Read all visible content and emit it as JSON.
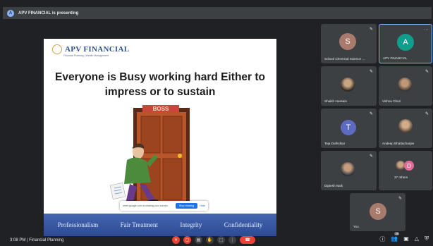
{
  "presenting_banner": "APV FINANCIAL is presenting",
  "presenter_initial": "A",
  "slide": {
    "logo_text": "APV FINANCIAL",
    "logo_subtitle": "Financial Planning | Wealth Management",
    "title_line1": "Everyone is Busy working hard Either to",
    "title_line2": "impress or to sustain",
    "door_sign": "BOSS",
    "footer": [
      "Professionalism",
      "Fair Treatment",
      "Integrity",
      "Confidentiality"
    ]
  },
  "share_popup": {
    "text": "meet.google.com is sharing your screen.",
    "stop_label": "Stop sharing",
    "hide_label": "Hide"
  },
  "participants": [
    {
      "name": "School Chemical Science ...",
      "initial": "S",
      "color": "#a87b6c"
    },
    {
      "name": "APV FINANCIAL",
      "initial": "A",
      "color": "#0f9d8c",
      "active": true
    },
    {
      "name": "Shaikh Hussain",
      "initial": "",
      "color": "#5b4a3f"
    },
    {
      "name": "Vishnu Churi",
      "initial": "",
      "color": "#4f4740"
    },
    {
      "name": "Teja Dolholkar",
      "initial": "T",
      "color": "#5c6bc0"
    },
    {
      "name": "Andeep Bhattacharjee",
      "initial": "",
      "color": "#6b5a4f"
    },
    {
      "name": "Diptesh Naik",
      "initial": "",
      "color": "#2f3f52"
    },
    {
      "name": "37 others",
      "initial": "D",
      "color": "#e46b99"
    },
    {
      "name": "You",
      "initial": "S",
      "color": "#a87b6c"
    }
  ],
  "bottom": {
    "time": "3:08 PM",
    "separator": "|",
    "meeting_title": "Financial Planning",
    "participant_count": "46"
  },
  "icons": {
    "mic_off": "mic-off-icon",
    "camera_off": "camera-off-icon",
    "captions": "captions-icon",
    "raise_hand": "hand-icon",
    "present": "present-icon",
    "more": "more-icon",
    "end_call": "end-call-icon",
    "info": "info-icon",
    "people": "people-icon",
    "chat": "chat-icon",
    "activities": "activities-icon",
    "host_controls": "host-controls-icon"
  }
}
